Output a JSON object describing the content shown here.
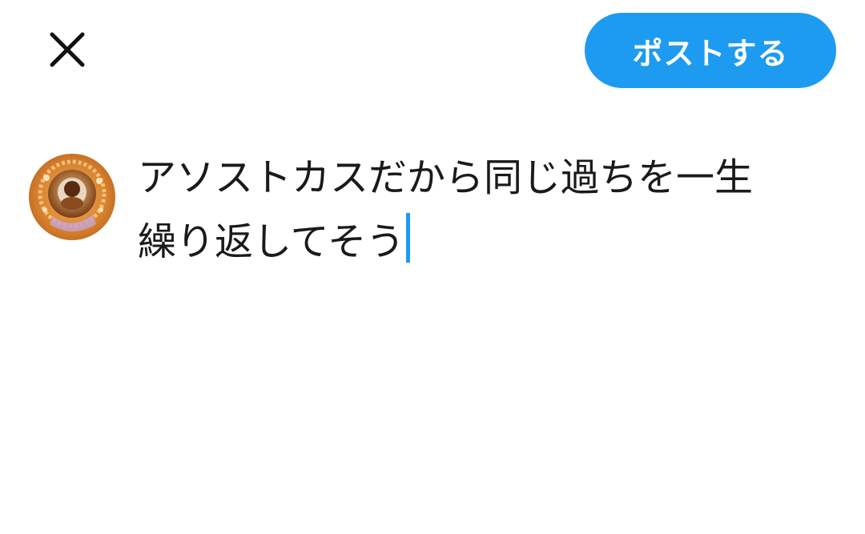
{
  "colors": {
    "accent": "#1d9bf0",
    "text": "#1a1a1a",
    "icon": "#111111",
    "background": "#ffffff"
  },
  "toolbar": {
    "close_icon": "close-icon",
    "post_label": "ポストする"
  },
  "composer": {
    "avatar_icon": "user-avatar",
    "line1": "アソストカスだから同じ過ちを一生",
    "line2": "繰り返してそう"
  }
}
